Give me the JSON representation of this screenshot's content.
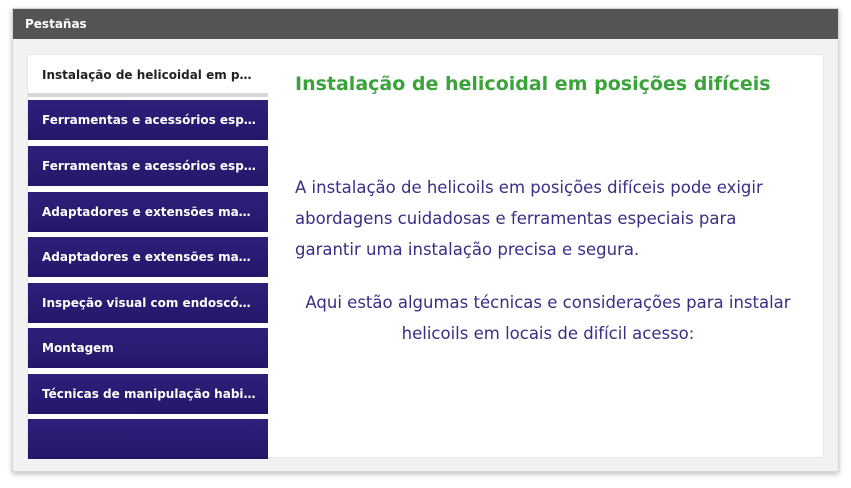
{
  "panel": {
    "header_title": "Pestañas"
  },
  "tabs": [
    {
      "label": "Instalação de helicoidal em posiç..."
    },
    {
      "label": "Ferramentas e acessórios especiais"
    },
    {
      "label": "Ferramentas e acessórios especiais"
    },
    {
      "label": "Adaptadores e extensões magné..."
    },
    {
      "label": "Adaptadores e extensões magné..."
    },
    {
      "label": "Inspeção visual com endoscópio"
    },
    {
      "label": "Montagem"
    },
    {
      "label": "Técnicas de manipulação habilid..."
    },
    {
      "label": ""
    }
  ],
  "active_tab_index": 0,
  "content": {
    "title": "Instalação de helicoidal em posições difíceis",
    "paragraph1": "A instalação de helicoils em posições difíceis pode exigir abordagens cuidadosas e ferramentas especiais para garantir uma instalação precisa e segura.",
    "paragraph2": "Aqui estão algumas técnicas e considerações para instalar helicoils em locais de difícil acesso:"
  },
  "colors": {
    "header_bg": "#545454",
    "tab_bg": "#2a1c74",
    "title_green": "#3aa33a",
    "body_text": "#3b2d86"
  }
}
